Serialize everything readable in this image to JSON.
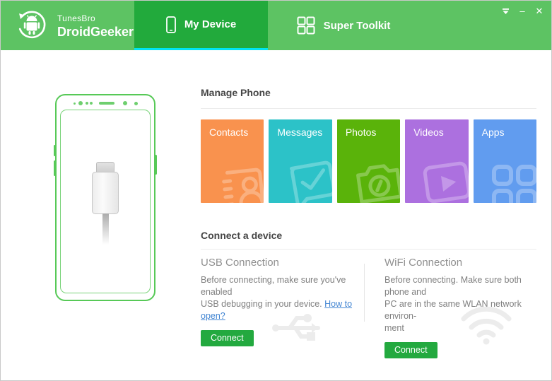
{
  "header": {
    "brand": {
      "line1": "TunesBro",
      "line2": "DroidGeeker"
    },
    "tabs": [
      {
        "label": "My Device",
        "active": true
      },
      {
        "label": "Super Toolkit",
        "active": false
      }
    ],
    "controls": {
      "menu": "",
      "minimize": "–",
      "close": "✕"
    },
    "colors": {
      "bar": "#5dc363",
      "active_tab": "#22aa3c",
      "active_underline": "#00e4f2"
    }
  },
  "manage_phone": {
    "title": "Manage Phone",
    "tiles": [
      {
        "label": "Contacts",
        "color": "#f9924e"
      },
      {
        "label": "Messages",
        "color": "#2cc2c8"
      },
      {
        "label": "Photos",
        "color": "#5ab30a"
      },
      {
        "label": "Videos",
        "color": "#ac70df"
      },
      {
        "label": "Apps",
        "color": "#619cef"
      }
    ]
  },
  "connect_device": {
    "title": "Connect a device",
    "usb": {
      "title": "USB Connection",
      "line1": "Before connecting, make sure you've enabled",
      "line2": "USB debugging in your device. ",
      "link": "How to open?",
      "button": "Connect"
    },
    "wifi": {
      "title": "WiFi Connection",
      "line1": "Before connecting. Make sure both phone and",
      "line2": "PC are in the same WLAN network environ-",
      "line3": "ment",
      "button": "Connect"
    },
    "button_color": "#23a93f"
  }
}
